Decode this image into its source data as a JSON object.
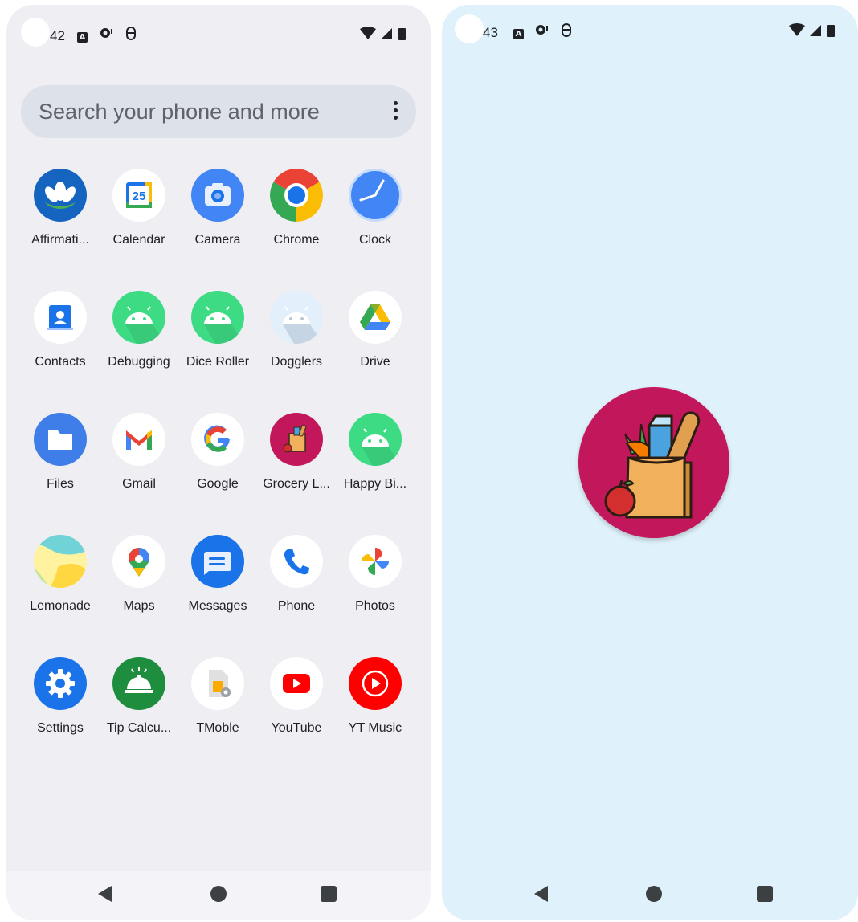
{
  "left_phone": {
    "status": {
      "time": "42"
    },
    "search": {
      "placeholder": "Search your phone and more"
    },
    "apps": [
      {
        "label": "Affirmati...",
        "icon": "affirmations-icon"
      },
      {
        "label": "Calendar",
        "icon": "calendar-icon",
        "badge": "25"
      },
      {
        "label": "Camera",
        "icon": "camera-icon"
      },
      {
        "label": "Chrome",
        "icon": "chrome-icon"
      },
      {
        "label": "Clock",
        "icon": "clock-icon"
      },
      {
        "label": "Contacts",
        "icon": "contacts-icon"
      },
      {
        "label": "Debugging",
        "icon": "android-icon"
      },
      {
        "label": "Dice Roller",
        "icon": "android-icon"
      },
      {
        "label": "Dogglers",
        "icon": "android-icon"
      },
      {
        "label": "Drive",
        "icon": "drive-icon"
      },
      {
        "label": "Files",
        "icon": "files-icon"
      },
      {
        "label": "Gmail",
        "icon": "gmail-icon"
      },
      {
        "label": "Google",
        "icon": "google-icon"
      },
      {
        "label": "Grocery L...",
        "icon": "grocery-icon"
      },
      {
        "label": "Happy Bi...",
        "icon": "android-icon"
      },
      {
        "label": "Lemonade",
        "icon": "lemonade-icon"
      },
      {
        "label": "Maps",
        "icon": "maps-icon"
      },
      {
        "label": "Messages",
        "icon": "messages-icon"
      },
      {
        "label": "Phone",
        "icon": "phone-icon"
      },
      {
        "label": "Photos",
        "icon": "photos-icon"
      },
      {
        "label": "Settings",
        "icon": "settings-icon"
      },
      {
        "label": "Tip Calcu...",
        "icon": "tip-calculator-icon"
      },
      {
        "label": "TMoble",
        "icon": "sim-card-icon"
      },
      {
        "label": "YouTube",
        "icon": "youtube-icon"
      },
      {
        "label": "YT Music",
        "icon": "yt-music-icon"
      }
    ]
  },
  "right_phone": {
    "status": {
      "time": "43"
    },
    "splash": {
      "icon": "grocery-bag-icon"
    }
  },
  "colors": {
    "left_background": "#eeeef3",
    "right_background": "#dff1fb",
    "splash_circle": "#c2185b"
  }
}
